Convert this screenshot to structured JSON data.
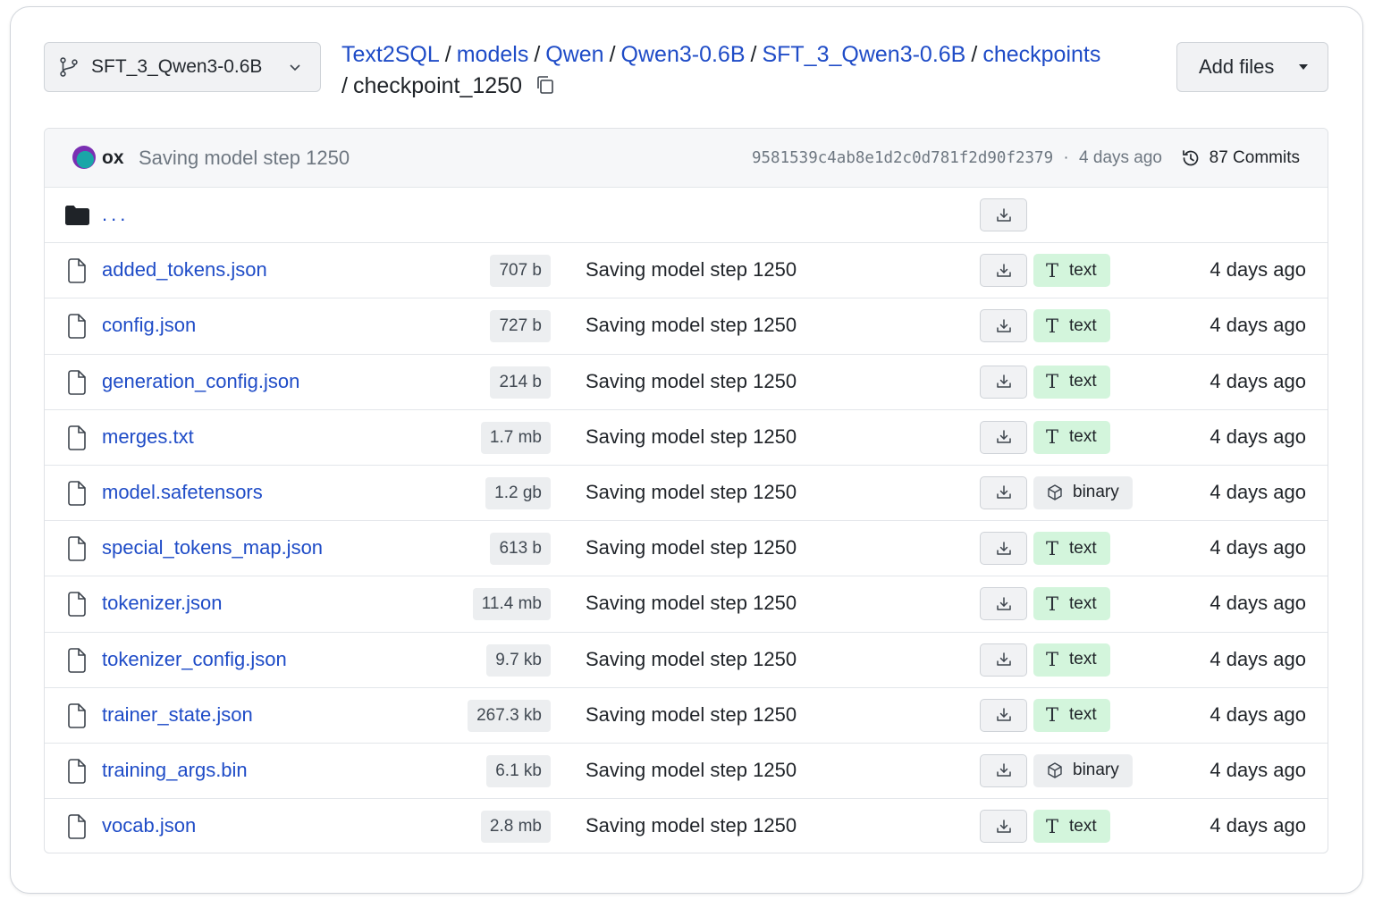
{
  "branch": {
    "name": "SFT_3_Qwen3-0.6B"
  },
  "breadcrumb": {
    "links": [
      "Text2SQL",
      "models",
      "Qwen",
      "Qwen3-0.6B",
      "SFT_3_Qwen3-0.6B",
      "checkpoints"
    ],
    "separator": "/",
    "current": "checkpoint_1250"
  },
  "add_files": {
    "label": "Add files"
  },
  "commit": {
    "author": "ox",
    "message": "Saving model step 1250",
    "hash": "9581539c4ab8e1d2c0d781f2d90f2379",
    "meta_sep": "·",
    "time": "4 days ago",
    "commits_label": "87 Commits"
  },
  "parent_row": {
    "label": "..."
  },
  "files": [
    {
      "name": "added_tokens.json",
      "size": "707 b",
      "message": "Saving model step 1250",
      "type": "text",
      "date": "4 days ago"
    },
    {
      "name": "config.json",
      "size": "727 b",
      "message": "Saving model step 1250",
      "type": "text",
      "date": "4 days ago"
    },
    {
      "name": "generation_config.json",
      "size": "214 b",
      "message": "Saving model step 1250",
      "type": "text",
      "date": "4 days ago"
    },
    {
      "name": "merges.txt",
      "size": "1.7 mb",
      "message": "Saving model step 1250",
      "type": "text",
      "date": "4 days ago"
    },
    {
      "name": "model.safetensors",
      "size": "1.2 gb",
      "message": "Saving model step 1250",
      "type": "binary",
      "date": "4 days ago"
    },
    {
      "name": "special_tokens_map.json",
      "size": "613 b",
      "message": "Saving model step 1250",
      "type": "text",
      "date": "4 days ago"
    },
    {
      "name": "tokenizer.json",
      "size": "11.4 mb",
      "message": "Saving model step 1250",
      "type": "text",
      "date": "4 days ago"
    },
    {
      "name": "tokenizer_config.json",
      "size": "9.7 kb",
      "message": "Saving model step 1250",
      "type": "text",
      "date": "4 days ago"
    },
    {
      "name": "trainer_state.json",
      "size": "267.3 kb",
      "message": "Saving model step 1250",
      "type": "text",
      "date": "4 days ago"
    },
    {
      "name": "training_args.bin",
      "size": "6.1 kb",
      "message": "Saving model step 1250",
      "type": "binary",
      "date": "4 days ago"
    },
    {
      "name": "vocab.json",
      "size": "2.8 mb",
      "message": "Saving model step 1250",
      "type": "text",
      "date": "4 days ago"
    }
  ],
  "icons": {
    "branch": "git-branch-icon",
    "copy": "copy-icon",
    "folder": "folder-icon",
    "file": "file-icon",
    "download": "download-icon",
    "history": "history-icon",
    "text_type": "text-type-icon",
    "binary_type": "cube-icon"
  },
  "colors": {
    "link": "#1f4cc7",
    "text_badge": "#d3f5dc",
    "binary_badge": "#eceef0"
  }
}
